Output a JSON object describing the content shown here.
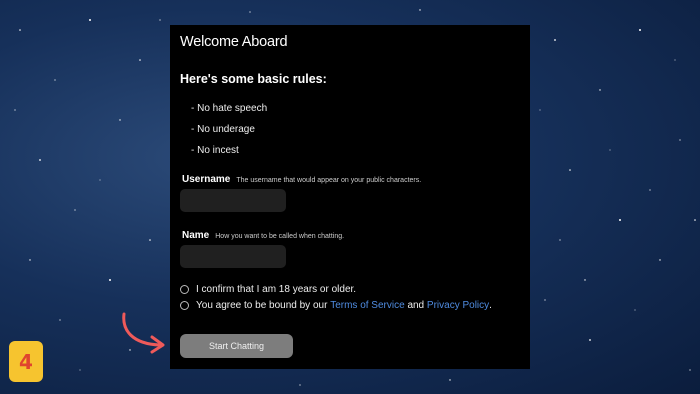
{
  "modal": {
    "title": "Welcome Aboard",
    "rules_heading": "Here's some basic rules:",
    "rules": [
      "- No hate speech",
      "- No underage",
      "- No incest"
    ],
    "username": {
      "label": "Username",
      "hint": "The username that would appear on your public characters.",
      "value": ""
    },
    "name": {
      "label": "Name",
      "hint": "How you want to be called when chatting.",
      "value": ""
    },
    "age_confirm": {
      "text": "I confirm that I am 18 years or older.",
      "checked": false
    },
    "terms": {
      "prefix": "You agree to be bound by our",
      "terms_link": "Terms of Service",
      "conjunction": "and",
      "privacy_link": "Privacy Policy",
      "suffix": ".",
      "checked": false
    },
    "start_button": "Start Chatting"
  },
  "overlay": {
    "step_number": "4",
    "badge_color": "#f6c42f",
    "number_color": "#e0452e",
    "arrow_color": "#ef5a5a",
    "arrow_icon": "curved-arrow-icon"
  },
  "colors": {
    "modal_bg": "#000000",
    "input_bg": "#202020",
    "link": "#4f8be0",
    "button_bg": "#7d7d7d"
  }
}
